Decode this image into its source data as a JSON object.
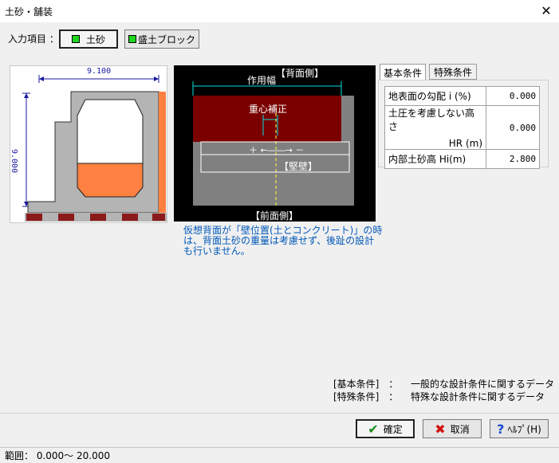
{
  "window": {
    "title": "土砂・舗装",
    "close_glyph": "✕"
  },
  "input": {
    "label": "入力項目 ：",
    "buttons": [
      {
        "label": "土砂",
        "selected": true
      },
      {
        "label": "盛土ブロック",
        "selected": false
      }
    ]
  },
  "section_view": {
    "width_label": "9.100",
    "height_label": "9.000"
  },
  "diagram": {
    "back_label": "【背面側】",
    "front_label": "【前面側】",
    "width_label": "作用幅",
    "center_label": "重心補正",
    "sign_label": "＋ ←――→ －",
    "wall_label": "【堅壁】"
  },
  "note": "仮想背面が「壁位置(土とコンクリート)」の時は、背面土砂の重量は考慮せず、後趾の設計も行いません。",
  "tabs": [
    {
      "label": "基本条件",
      "active": true
    },
    {
      "label": "特殊条件",
      "active": false
    }
  ],
  "params": [
    {
      "label": "地表面の勾配  i (%)",
      "value": "0.000"
    },
    {
      "label": "土圧を考慮しない高さ",
      "sub": "HR (m)",
      "value": "0.000"
    },
    {
      "label": "内部土砂高    Hi(m)",
      "value": "2.800"
    }
  ],
  "legend": [
    {
      "key": "[基本条件]",
      "sep": "：",
      "desc": "一般的な設計条件に関するデータ"
    },
    {
      "key": "[特殊条件]",
      "sep": "：",
      "desc": "特殊な設計条件に関するデータ"
    }
  ],
  "footer": {
    "ok": "確定",
    "cancel": "取消",
    "help": "ﾍﾙﾌﾟ(H)"
  },
  "status": {
    "text": "範囲： 0.000～ 20.000"
  },
  "colors": {
    "note_text": "#0058b8",
    "soil_dark": "#7a0000",
    "fill_orange": "#ff8040",
    "brick": "#8b1a1a"
  }
}
